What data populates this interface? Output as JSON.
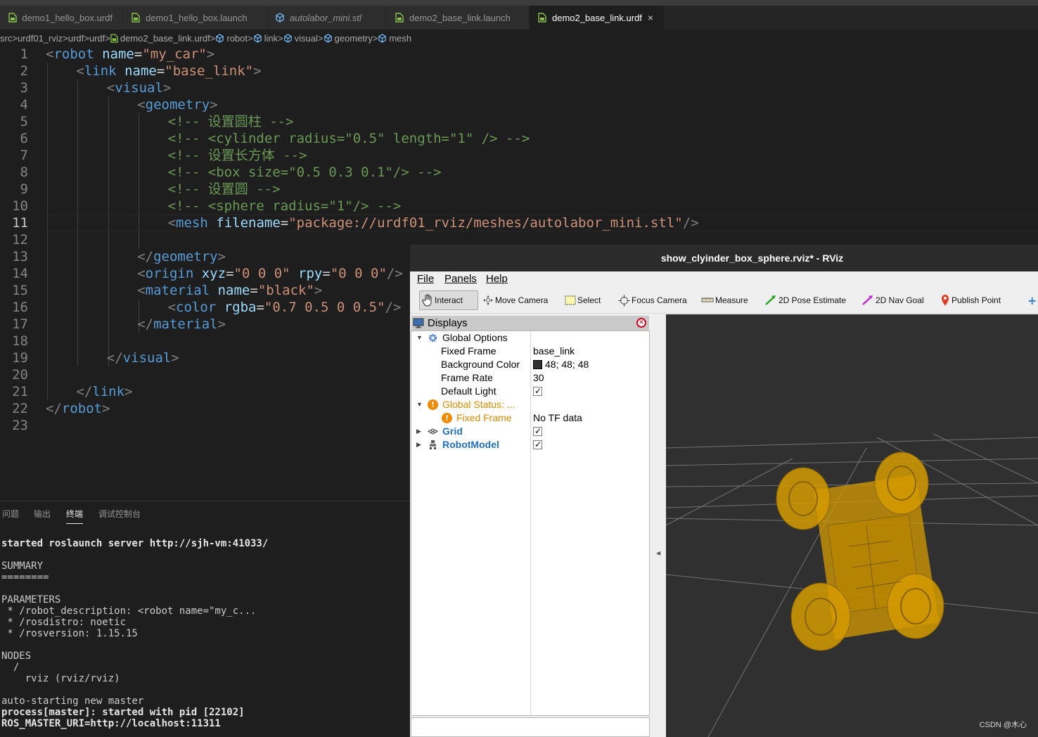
{
  "editor": {
    "tabs": [
      {
        "label": "demo1_hello_box.urdf",
        "icon": "file-icon",
        "active": false
      },
      {
        "label": "demo1_hello_box.launch",
        "icon": "file-icon",
        "active": false
      },
      {
        "label": "autolabor_mini.stl",
        "icon": "cube-icon",
        "active": false
      },
      {
        "label": "demo2_base_link.launch",
        "icon": "file-icon",
        "active": false
      },
      {
        "label": "demo2_base_link.urdf",
        "icon": "file-icon",
        "active": true
      }
    ],
    "tab_close": "×",
    "breadcrumb": [
      "src",
      "urdf01_rviz",
      "urdf",
      "urdf",
      "demo2_base_link.urdf",
      "robot",
      "link",
      "visual",
      "geometry",
      "mesh"
    ],
    "breadcrumb_sep": ">",
    "line_numbers": [
      "1",
      "2",
      "3",
      "4",
      "5",
      "6",
      "7",
      "8",
      "9",
      "10",
      "11",
      "12",
      "13",
      "14",
      "15",
      "16",
      "17",
      "18",
      "19",
      "20",
      "21",
      "22",
      "23"
    ],
    "current_line": "11",
    "lines": [
      {
        "t": [
          [
            "<",
            "punct"
          ],
          [
            "robot",
            "tag"
          ],
          [
            " ",
            ""
          ],
          [
            "name",
            "attr"
          ],
          [
            "=",
            "eq"
          ],
          [
            "\"my_car\"",
            "str"
          ],
          [
            ">",
            "punct"
          ]
        ]
      },
      {
        "t": [
          [
            "<",
            "punct"
          ],
          [
            "link",
            "tag"
          ],
          [
            " ",
            ""
          ],
          [
            "name",
            "attr"
          ],
          [
            "=",
            "eq"
          ],
          [
            "\"base_link\"",
            "str"
          ],
          [
            ">",
            "punct"
          ]
        ]
      },
      {
        "t": [
          [
            "<",
            "punct"
          ],
          [
            "visual",
            "tag"
          ],
          [
            ">",
            "punct"
          ]
        ]
      },
      {
        "t": [
          [
            "<",
            "punct"
          ],
          [
            "geometry",
            "tag"
          ],
          [
            ">",
            "punct"
          ]
        ]
      },
      {
        "t": [
          [
            "<!-- 设置圆柱 -->",
            "com"
          ]
        ]
      },
      {
        "t": [
          [
            "<!-- <cylinder radius=\"0.5\" length=\"1\" /> -->",
            "com"
          ]
        ]
      },
      {
        "t": [
          [
            "<!-- 设置长方体 -->",
            "com"
          ]
        ]
      },
      {
        "t": [
          [
            "<!-- <box size=\"0.5 0.3 0.1\"/> -->",
            "com"
          ]
        ]
      },
      {
        "t": [
          [
            "<!-- 设置圆 -->",
            "com"
          ]
        ]
      },
      {
        "t": [
          [
            "<!-- <sphere radius=\"1\"/> -->",
            "com"
          ]
        ]
      },
      {
        "t": [
          [
            "<",
            "punct"
          ],
          [
            "mesh",
            "tag"
          ],
          [
            " ",
            ""
          ],
          [
            "filename",
            "attr"
          ],
          [
            "=",
            "eq"
          ],
          [
            "\"package://urdf01_rviz/meshes/autolabor_mini.stl\"",
            "str"
          ],
          [
            "/>",
            "punct"
          ]
        ]
      },
      {
        "t": []
      },
      {
        "t": [
          [
            "</",
            "punct"
          ],
          [
            "geometry",
            "tag"
          ],
          [
            ">",
            "punct"
          ]
        ]
      },
      {
        "t": [
          [
            "<",
            "punct"
          ],
          [
            "origin",
            "tag"
          ],
          [
            " ",
            ""
          ],
          [
            "xyz",
            "attr"
          ],
          [
            "=",
            "eq"
          ],
          [
            "\"0 0 0\"",
            "str"
          ],
          [
            " ",
            ""
          ],
          [
            "rpy",
            "attr"
          ],
          [
            "=",
            "eq"
          ],
          [
            "\"0 0 0\"",
            "str"
          ],
          [
            "/>",
            "punct"
          ]
        ]
      },
      {
        "t": [
          [
            "<",
            "punct"
          ],
          [
            "material",
            "tag"
          ],
          [
            " ",
            ""
          ],
          [
            "name",
            "attr"
          ],
          [
            "=",
            "eq"
          ],
          [
            "\"black\"",
            "str"
          ],
          [
            ">",
            "punct"
          ]
        ]
      },
      {
        "t": [
          [
            "<",
            "punct"
          ],
          [
            "color",
            "tag"
          ],
          [
            " ",
            ""
          ],
          [
            "rgba",
            "attr"
          ],
          [
            "=",
            "eq"
          ],
          [
            "\"0.7 0.5 0 0.5\"",
            "str"
          ],
          [
            "/>",
            "punct"
          ]
        ]
      },
      {
        "t": [
          [
            "</",
            "punct"
          ],
          [
            "material",
            "tag"
          ],
          [
            ">",
            "punct"
          ]
        ]
      },
      {
        "t": []
      },
      {
        "t": [
          [
            "</",
            "punct"
          ],
          [
            "visual",
            "tag"
          ],
          [
            ">",
            "punct"
          ]
        ]
      },
      {
        "t": []
      },
      {
        "t": [
          [
            "</",
            "punct"
          ],
          [
            "link",
            "tag"
          ],
          [
            ">",
            "punct"
          ]
        ]
      },
      {
        "t": [
          [
            "</",
            "punct"
          ],
          [
            "robot",
            "tag"
          ],
          [
            ">",
            "punct"
          ]
        ]
      },
      {
        "t": []
      }
    ]
  },
  "panel": {
    "tabs": [
      "问题",
      "输出",
      "终端",
      "调试控制台"
    ],
    "active_tab": "终端"
  },
  "terminal": {
    "lines": [
      {
        "text": "",
        "bold": false
      },
      {
        "text": "started roslaunch server http://sjh-vm:41033/",
        "bold": true
      },
      {
        "text": "",
        "bold": false
      },
      {
        "text": "SUMMARY",
        "bold": false
      },
      {
        "text": "========",
        "bold": false
      },
      {
        "text": "",
        "bold": false
      },
      {
        "text": "PARAMETERS",
        "bold": false
      },
      {
        "text": " * /robot_description: <robot name=\"my_c...",
        "bold": false
      },
      {
        "text": " * /rosdistro: noetic",
        "bold": false
      },
      {
        "text": " * /rosversion: 1.15.15",
        "bold": false
      },
      {
        "text": "",
        "bold": false
      },
      {
        "text": "NODES",
        "bold": false
      },
      {
        "text": "  /",
        "bold": false
      },
      {
        "text": "    rviz (rviz/rviz)",
        "bold": false
      },
      {
        "text": "",
        "bold": false
      },
      {
        "text": "auto-starting new master",
        "bold": false
      },
      {
        "text": "process[master]: started with pid [22102]",
        "bold": true
      },
      {
        "text": "ROS_MASTER_URI=http://localhost:11311",
        "bold": true
      }
    ]
  },
  "rviz": {
    "title": "show_clyinder_box_sphere.rviz* - RViz",
    "menu": [
      "File",
      "Panels",
      "Help"
    ],
    "tools": [
      {
        "label": "Interact",
        "icon": "hand-icon",
        "active": true
      },
      {
        "label": "Move Camera",
        "icon": "move-camera-icon",
        "active": false
      },
      {
        "label": "Select",
        "icon": "select-icon",
        "active": false
      },
      {
        "label": "Focus Camera",
        "icon": "focus-camera-icon",
        "active": false
      },
      {
        "label": "Measure",
        "icon": "ruler-icon",
        "active": false
      },
      {
        "label": "2D Pose Estimate",
        "icon": "pose-arrow-icon",
        "active": false
      },
      {
        "label": "2D Nav Goal",
        "icon": "nav-goal-icon",
        "active": false
      },
      {
        "label": "Publish Point",
        "icon": "map-pin-icon",
        "active": false
      }
    ],
    "displays_title": "Displays",
    "tree": {
      "global_options": "Global Options",
      "fixed_frame_label": "Fixed Frame",
      "fixed_frame_value": "base_link",
      "bg_color_label": "Background Color",
      "bg_color_value": "48; 48; 48",
      "frame_rate_label": "Frame Rate",
      "frame_rate_value": "30",
      "default_light_label": "Default Light",
      "global_status": "Global Status: ...",
      "fixed_frame_status": "Fixed Frame",
      "fixed_frame_status_value": "No TF data",
      "grid": "Grid",
      "robot_model": "RobotModel"
    },
    "colors": {
      "warning": "#d98c00",
      "display_link": "#1f6fc4",
      "model": "#d59b00",
      "background": "#303030"
    }
  },
  "watermark": "CSDN @木心"
}
